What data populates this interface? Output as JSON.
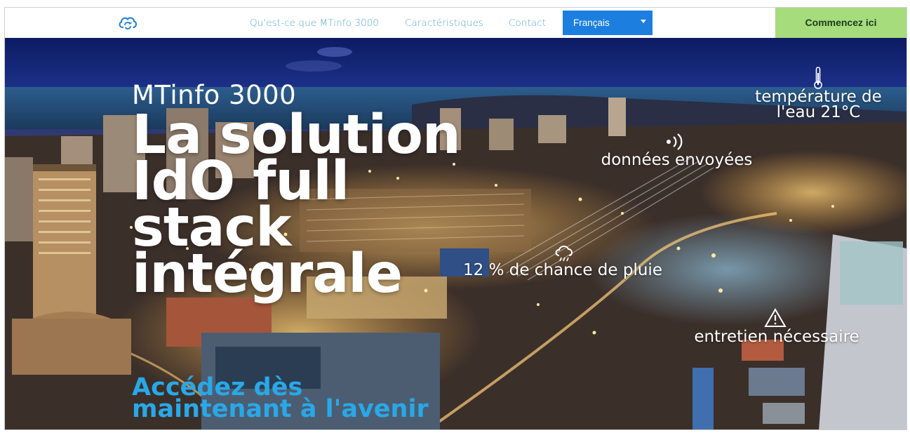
{
  "nav": {
    "logo_icon": "cloud-sync-icon",
    "links": [
      {
        "label": "Qu'est-ce que MTinfo 3000"
      },
      {
        "label": "Caractéristiques"
      },
      {
        "label": "Contact"
      }
    ],
    "language": {
      "selected": "Français",
      "icon": "chevron-down-icon"
    },
    "cta_label": "Commencez ici"
  },
  "hero": {
    "subtitle": "MTinfo 3000",
    "title": "La solution IdO full stack intégrale",
    "tagline": "Accédez dès maintenant à l'avenir",
    "overlays": [
      {
        "label": "température de l'eau 21°C",
        "icon": "thermometer-icon"
      },
      {
        "label": "données envoyées",
        "icon": "signal-icon"
      },
      {
        "label": "12 % de chance de pluie",
        "icon": "rain-cloud-icon"
      },
      {
        "label": "entretien nécessaire",
        "icon": "warning-icon"
      }
    ]
  },
  "colors": {
    "nav_link": "#5aa7d6",
    "language_bg": "#1c7fe0",
    "cta_bg": "#a6dc7c",
    "tagline": "#29a8e8"
  }
}
